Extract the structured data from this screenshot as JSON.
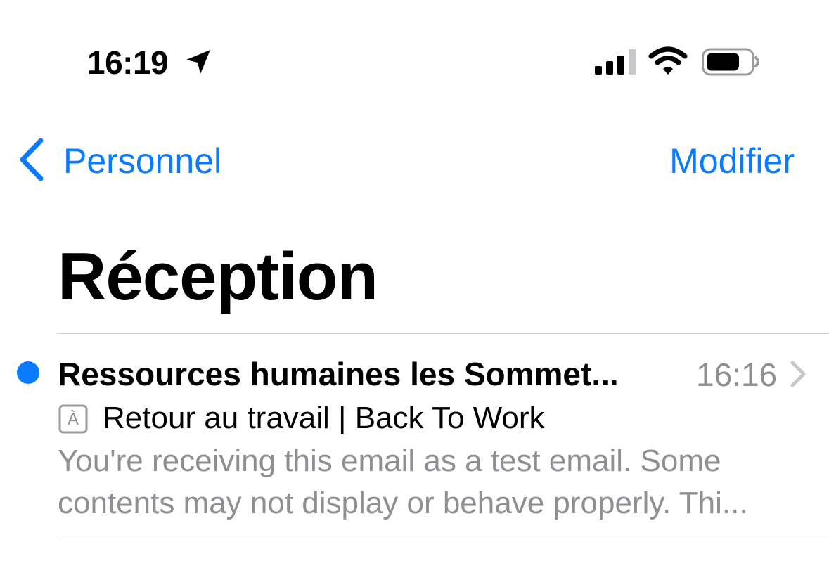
{
  "status_bar": {
    "time": "16:19",
    "icons": [
      "location-arrow-icon",
      "cellular-signal-icon",
      "wifi-icon",
      "battery-icon"
    ]
  },
  "nav": {
    "back_label": "Personnel",
    "edit_label": "Modifier"
  },
  "title": "Réception",
  "colors": {
    "accent": "#0A7AFF",
    "secondary_text": "#8E8E93",
    "divider": "#CFCFD4"
  },
  "mails": [
    {
      "unread": true,
      "sender": "Ressources humaines les Sommet...",
      "time": "16:16",
      "subject": "Retour au travail | Back To Work",
      "preview_line1": "You're receiving this email as a test email. Some",
      "preview_line2": "contents may not display or behave properly. Thi...",
      "translate_glyph": "À"
    }
  ]
}
